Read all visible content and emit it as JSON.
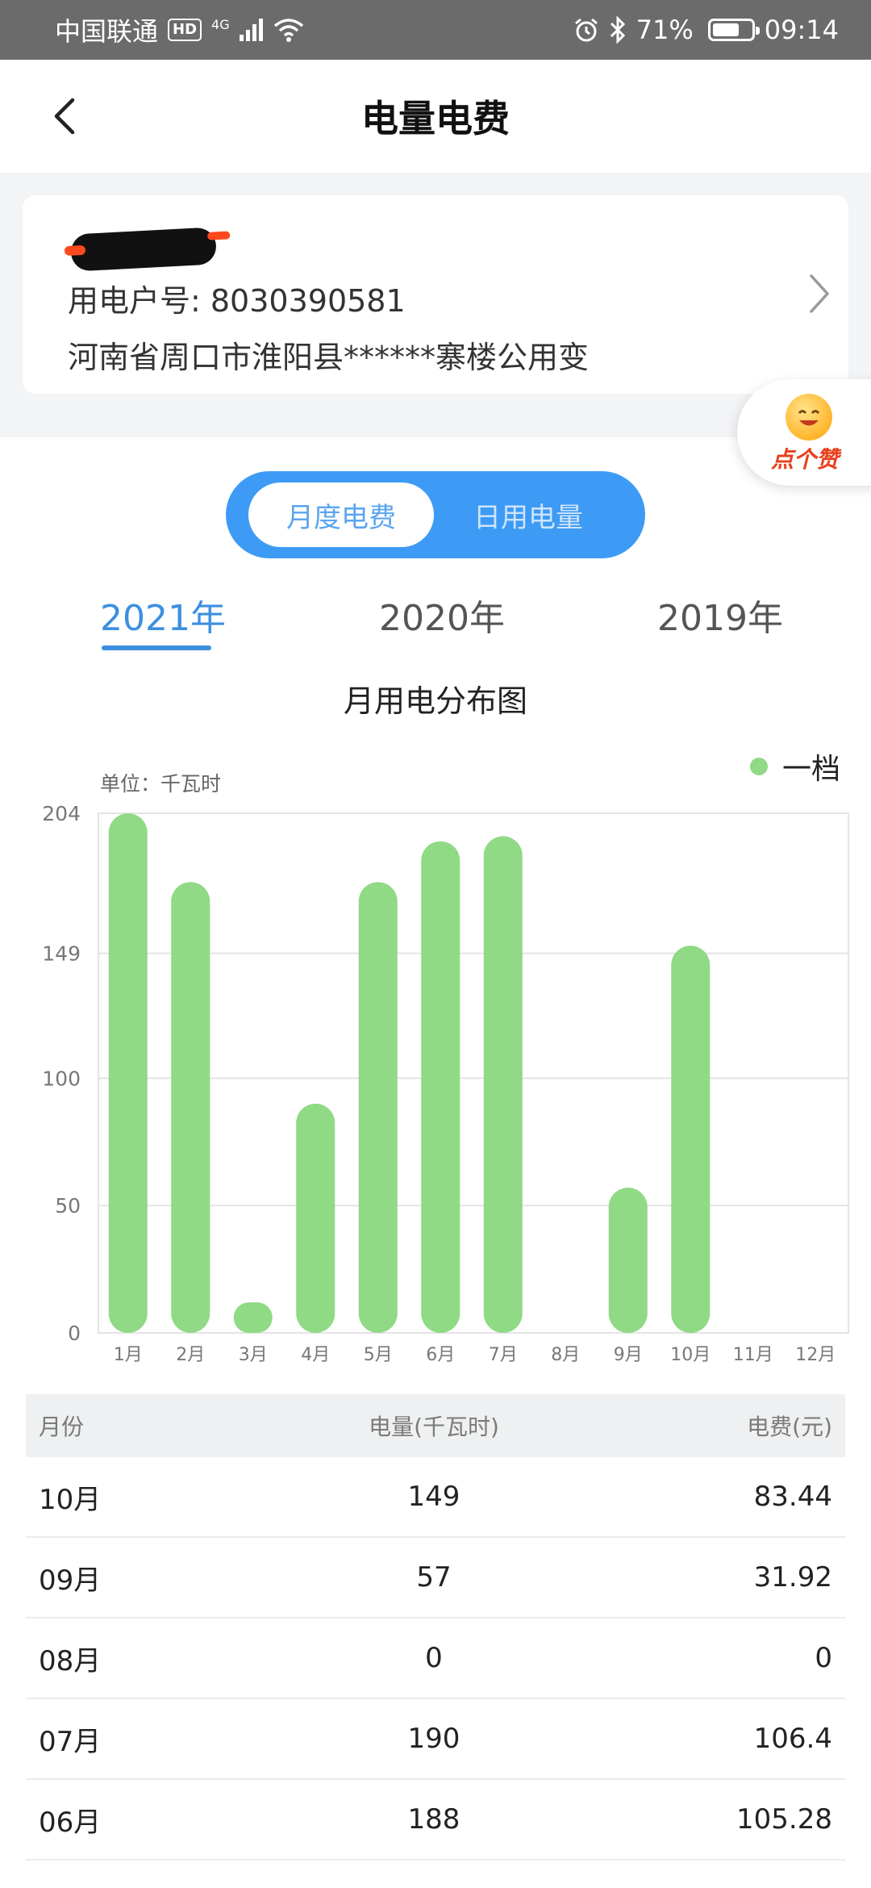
{
  "status_bar": {
    "carrier": "中国联通",
    "hd": "HD",
    "net": "4G",
    "battery": "71%",
    "battery_level": 0.71,
    "time": "09:14"
  },
  "header": {
    "title": "电量电费"
  },
  "account": {
    "number_label": "用电户号: 8030390581",
    "address": "河南省周口市淮阳县******寨楼公用变"
  },
  "like_button": {
    "label": "点个赞"
  },
  "toggle": {
    "options": [
      "月度电费",
      "日用电量"
    ],
    "selected": "月度电费"
  },
  "year_tabs": {
    "items": [
      "2021年",
      "2020年",
      "2019年"
    ],
    "selected": "2021年"
  },
  "colors": {
    "accent": "#3d8fe0",
    "bar": "#90d985"
  },
  "chart_data": {
    "type": "bar",
    "title": "月用电分布图",
    "unit_label": "单位：千瓦时",
    "series": [
      {
        "name": "一档",
        "values": [
          204,
          177,
          12,
          90,
          177,
          193,
          195,
          0,
          57,
          152,
          0,
          0
        ]
      }
    ],
    "categories": [
      "1月",
      "2月",
      "3月",
      "4月",
      "5月",
      "6月",
      "7月",
      "8月",
      "9月",
      "10月",
      "11月",
      "12月"
    ],
    "yticks": [
      0,
      50,
      100,
      149,
      204
    ],
    "ylim": [
      0,
      204
    ],
    "grid": true,
    "legend_position": "top-right"
  },
  "table": {
    "headers": [
      "月份",
      "电量(千瓦时)",
      "电费(元)"
    ],
    "rows": [
      [
        "10月",
        "149",
        "83.44"
      ],
      [
        "09月",
        "57",
        "31.92"
      ],
      [
        "08月",
        "0",
        "0"
      ],
      [
        "07月",
        "190",
        "106.4"
      ],
      [
        "06月",
        "188",
        "105.28"
      ]
    ]
  }
}
